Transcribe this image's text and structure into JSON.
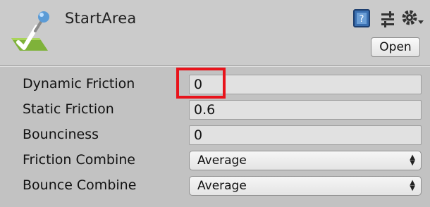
{
  "header": {
    "title": "StartArea",
    "icons": [
      "material-asset-icon",
      "help-icon",
      "presets-icon",
      "gear-icon"
    ],
    "open_label": "Open"
  },
  "properties": [
    {
      "label": "Dynamic Friction",
      "type": "number",
      "value": "0"
    },
    {
      "label": "Static Friction",
      "type": "number",
      "value": "0.6"
    },
    {
      "label": "Bounciness",
      "type": "number",
      "value": "0"
    },
    {
      "label": "Friction Combine",
      "type": "select",
      "value": "Average"
    },
    {
      "label": "Bounce Combine",
      "type": "select",
      "value": "Average"
    }
  ],
  "colors": {
    "highlight": "#e8131b",
    "panel_bg": "#c2c2c2",
    "header_bg": "#cbcbcb"
  }
}
